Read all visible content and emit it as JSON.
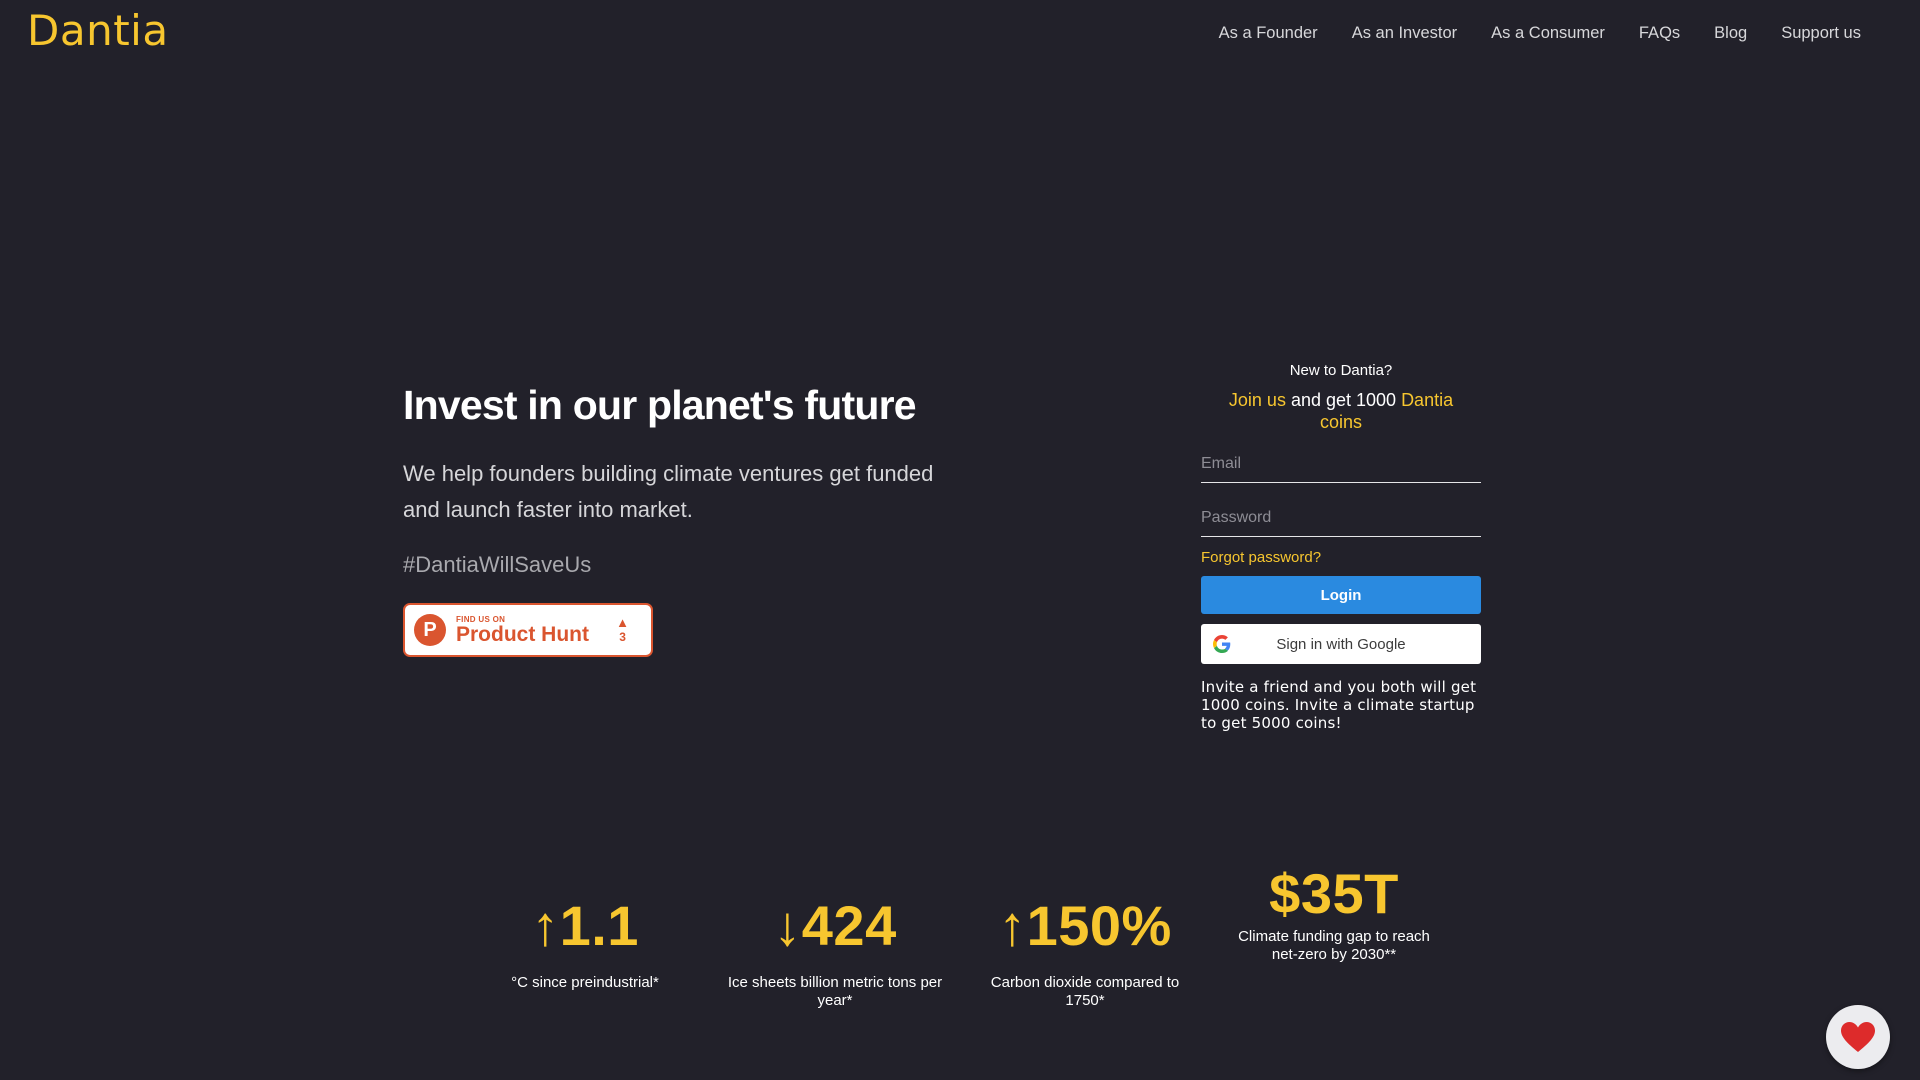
{
  "brand": {
    "logo_text": "Dantia",
    "accent_color": "#f7c62f",
    "background": "#22212a"
  },
  "nav": {
    "items": [
      {
        "label": "As a Founder"
      },
      {
        "label": "As an Investor"
      },
      {
        "label": "As a Consumer"
      },
      {
        "label": "FAQs"
      },
      {
        "label": "Blog"
      },
      {
        "label": "Support us"
      }
    ]
  },
  "hero": {
    "title": "Invest in our planet's future",
    "subtitle": "We help founders building climate ventures get funded and launch faster into market.",
    "hashtag": "#DantiaWillSaveUs",
    "product_hunt": {
      "icon": "product-hunt-icon",
      "logo_letter": "P",
      "find_text": "FIND US ON",
      "name": "Product Hunt",
      "upvote_icon": "▲",
      "upvotes": "3"
    }
  },
  "login": {
    "new_to": "New to Dantia?",
    "join_link": "Join us",
    "join_middle": " and get 1000 ",
    "join_coins": "Dantia coins",
    "email_placeholder": "Email",
    "email_value": "",
    "password_placeholder": "Password",
    "password_value": "",
    "forgot": "Forgot password?",
    "login_button": "Login",
    "login_button_color": "#2a8ae0",
    "google_button": "Sign in with Google",
    "google_icon": "google-icon",
    "invite_text": "Invite a friend and you both will get 1000 coins. Invite a climate startup to get 5000 coins!"
  },
  "stats": [
    {
      "value": "↑1.1",
      "label": "°C since preindustrial*"
    },
    {
      "value": "↓424",
      "label": "Ice sheets billion metric tons per year*"
    },
    {
      "value": "↑150%",
      "label": "Carbon dioxide compared to 1750*"
    },
    {
      "value": "$35T",
      "label": "Climate funding gap to reach net-zero by 2030**"
    }
  ],
  "floating_button": {
    "icon": "heart-icon",
    "glyph": "❤️"
  }
}
